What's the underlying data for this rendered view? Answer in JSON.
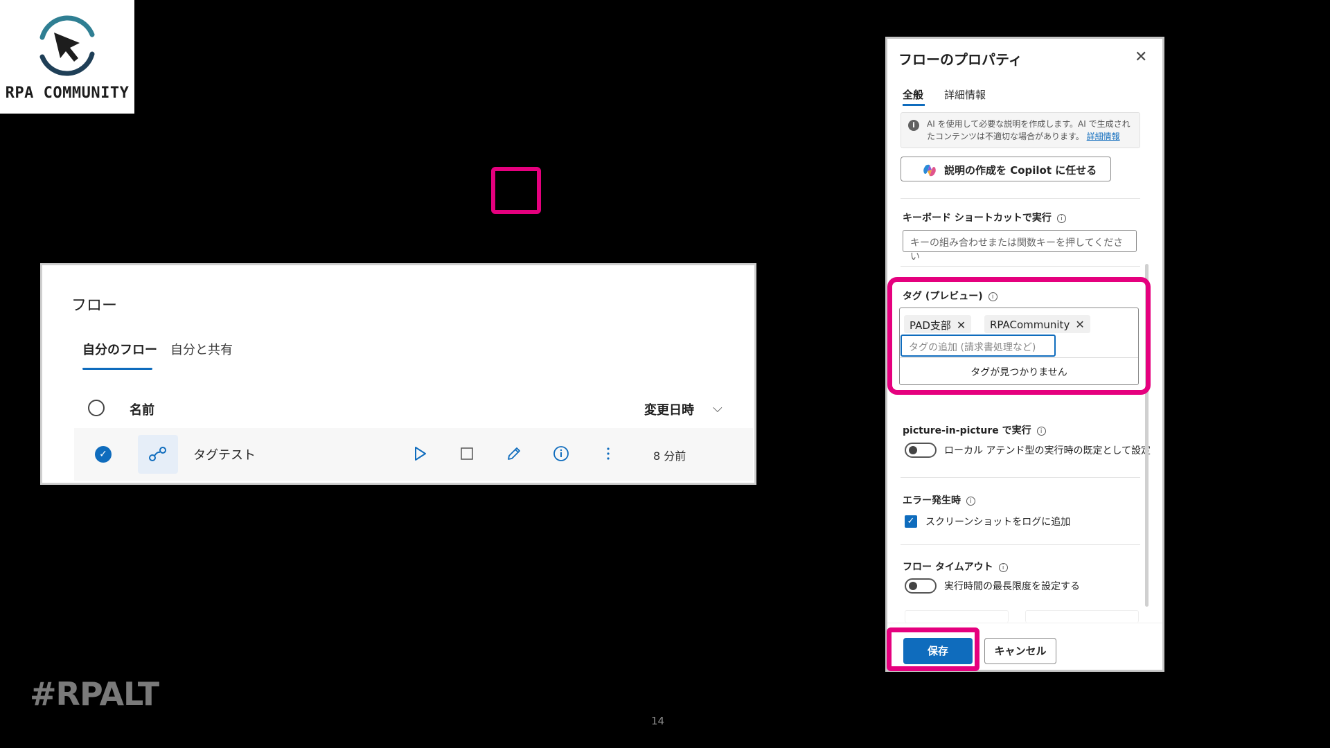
{
  "logo": {
    "text": "RPA COMMUNITY"
  },
  "footer": {
    "hashtag": "#RPALT",
    "page_number": "14"
  },
  "flows": {
    "title": "フロー",
    "tabs": [
      {
        "label": "自分のフロー",
        "active": true
      },
      {
        "label": "自分と共有",
        "active": false
      }
    ],
    "columns": {
      "name": "名前",
      "modified": "変更日時"
    },
    "rows": [
      {
        "name": "タグテスト",
        "modified": "8 分前",
        "selected": true
      }
    ]
  },
  "panel": {
    "title": "フローのプロパティ",
    "tabs": [
      {
        "label": "全般",
        "active": true
      },
      {
        "label": "詳細情報",
        "active": false
      }
    ],
    "info_text": "AI を使用して必要な説明を作成します。AI で生成されたコンテンツは不適切な場合があります。",
    "info_link": "詳細情報",
    "copilot_button": "説明の作成を Copilot に任せる",
    "keyboard_label": "キーボード ショートカットで実行",
    "keyboard_placeholder": "キーの組み合わせまたは関数キーを押してください",
    "tags_label": "タグ (プレビュー)",
    "tags": [
      "PAD支部",
      "RPACommunity"
    ],
    "tag_input_placeholder": "タグの追加 (請求書処理など)",
    "no_tags_text": "タグが見つかりません",
    "pip_label": "picture-in-picture で実行",
    "pip_toggle_text": "ローカル アテンド型の実行時の既定として設定",
    "error_label": "エラー発生時",
    "error_checkbox_text": "スクリーンショットをログに追加",
    "timeout_label": "フロー タイムアウト",
    "timeout_toggle_text": "実行時間の最長限度を設定する",
    "save_button": "保存",
    "cancel_button": "キャンセル"
  },
  "colors": {
    "accent": "#0f6cbd",
    "highlight": "#e5007e",
    "background": "#000000"
  }
}
